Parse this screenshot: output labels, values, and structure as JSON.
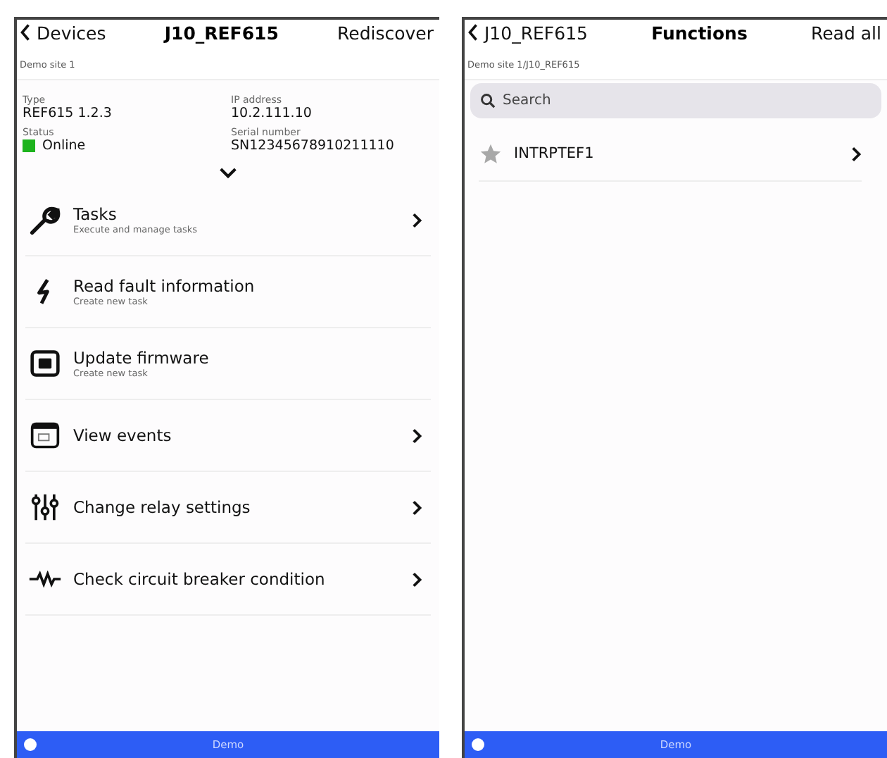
{
  "device_screen": {
    "nav": {
      "back": "Devices",
      "title": "J10_REF615",
      "action": "Rediscover"
    },
    "breadcrumb": "Demo site 1",
    "info": [
      {
        "label": "Type",
        "value": "REF615  1.2.3"
      },
      {
        "label": "IP address",
        "value": "10.2.111.10"
      },
      {
        "label": "Status",
        "value": "Online",
        "color": "#1db31d"
      },
      {
        "label": "Serial number",
        "value": "SN12345678910211110"
      }
    ],
    "expanded": false,
    "menu": [
      {
        "title": "Tasks",
        "subtitle": "Execute and manage tasks",
        "chevron": true
      },
      {
        "title": "Read fault information",
        "subtitle": "Create new task",
        "chevron": false
      },
      {
        "title": "Update firmware",
        "subtitle": "Create new task",
        "chevron": false
      },
      {
        "title": "View events",
        "chevron": true
      },
      {
        "title": "Change relay settings",
        "chevron": true
      },
      {
        "title": "Check circuit breaker condition",
        "chevron": true
      }
    ],
    "footer": "Demo"
  },
  "functions_screen": {
    "nav": {
      "back": "J10_REF615",
      "title": "Functions",
      "action": "Read all"
    },
    "breadcrumb": "Demo site 1/J10_REF615",
    "search": {
      "placeholder": "Search"
    },
    "items": [
      {
        "name": "INTRPTEF1",
        "favorite": false
      }
    ],
    "footer": "Demo"
  }
}
